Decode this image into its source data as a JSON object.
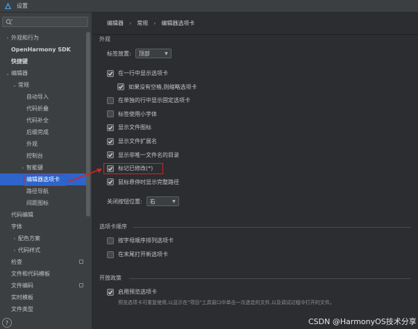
{
  "window": {
    "title": "设置"
  },
  "search": {
    "placeholder": ""
  },
  "sidebar": {
    "items": [
      {
        "label": "外观和行为",
        "level": 0,
        "arrow": "›",
        "bold": false
      },
      {
        "label": "OpenHarmony SDK",
        "level": 0,
        "arrow": "",
        "bold": true
      },
      {
        "label": "快捷键",
        "level": 0,
        "arrow": "",
        "bold": true
      },
      {
        "label": "编辑器",
        "level": 0,
        "arrow": "⌄",
        "bold": false
      },
      {
        "label": "常规",
        "level": 1,
        "arrow": "⌄",
        "bold": false
      },
      {
        "label": "自动导入",
        "level": 2,
        "arrow": "",
        "bold": false
      },
      {
        "label": "代码折叠",
        "level": 2,
        "arrow": "",
        "bold": false
      },
      {
        "label": "代码补全",
        "level": 2,
        "arrow": "",
        "bold": false
      },
      {
        "label": "后缀完成",
        "level": 2,
        "arrow": "",
        "bold": false
      },
      {
        "label": "外观",
        "level": 2,
        "arrow": "",
        "bold": false
      },
      {
        "label": "控制台",
        "level": 2,
        "arrow": "",
        "bold": false
      },
      {
        "label": "智能键",
        "level": 3,
        "arrow": "›",
        "bold": false
      },
      {
        "label": "编辑器选项卡",
        "level": 2,
        "arrow": "",
        "bold": false,
        "selected": true
      },
      {
        "label": "路径导航",
        "level": 2,
        "arrow": "",
        "bold": false
      },
      {
        "label": "间距图标",
        "level": 2,
        "arrow": "",
        "bold": false
      },
      {
        "label": "代码编辑",
        "level": 1,
        "arrow": "",
        "bold": false
      },
      {
        "label": "字体",
        "level": 1,
        "arrow": "",
        "bold": false
      },
      {
        "label": "配色方案",
        "level": 1,
        "arrow": "›",
        "bold": false
      },
      {
        "label": "代码样式",
        "level": 1,
        "arrow": "›",
        "bold": false
      },
      {
        "label": "检查",
        "level": 1,
        "arrow": "",
        "bold": false,
        "badge": true
      },
      {
        "label": "文件和代码模板",
        "level": 1,
        "arrow": "",
        "bold": false
      },
      {
        "label": "文件编码",
        "level": 1,
        "arrow": "",
        "bold": false,
        "badge": true
      },
      {
        "label": "实时模板",
        "level": 1,
        "arrow": "",
        "bold": false
      },
      {
        "label": "文件类型",
        "level": 1,
        "arrow": "",
        "bold": false
      }
    ],
    "help": "?"
  },
  "breadcrumb": [
    "编辑器",
    "常规",
    "编辑器选项卡"
  ],
  "appearance": {
    "section": "外观",
    "tab_placement_label": "标签放置:",
    "tab_placement_value": "顶部",
    "options": [
      {
        "label": "在一行中显示选项卡",
        "checked": true,
        "indent": 0
      },
      {
        "label": "如果没有空格,则缩略选项卡",
        "checked": true,
        "indent": 1
      },
      {
        "label": "在单独的行中显示固定选项卡",
        "checked": false,
        "indent": 0
      },
      {
        "label": "标签使用小字体",
        "checked": false,
        "indent": 0
      },
      {
        "label": "显示文件图标",
        "checked": true,
        "indent": 0
      },
      {
        "label": "显示文件扩展名",
        "checked": true,
        "indent": 0
      },
      {
        "label": "显示非唯一文件名的目录",
        "checked": true,
        "indent": 0
      },
      {
        "label": "标记已修改(*)",
        "checked": true,
        "indent": 0
      },
      {
        "label": "鼠标悬停时显示完整路径",
        "checked": true,
        "indent": 0
      }
    ],
    "close_button_label": "关闭按钮位置:",
    "close_button_value": "右"
  },
  "tab_order": {
    "section": "选项卡顺序",
    "options": [
      {
        "label": "按字母顺序排列选项卡",
        "checked": false
      },
      {
        "label": "在末尾打开新选项卡",
        "checked": false
      }
    ]
  },
  "opening_policy": {
    "section": "开放政策",
    "options": [
      {
        "label": "启用预览选项卡",
        "checked": true
      }
    ],
    "note": "预览选项卡可重复使用,以显示在\"项目\"工具窗口中单击一次选定的文件,以及调试过程中打开的文件。"
  },
  "watermark": "CSDN @HarmonyOS技术分享"
}
